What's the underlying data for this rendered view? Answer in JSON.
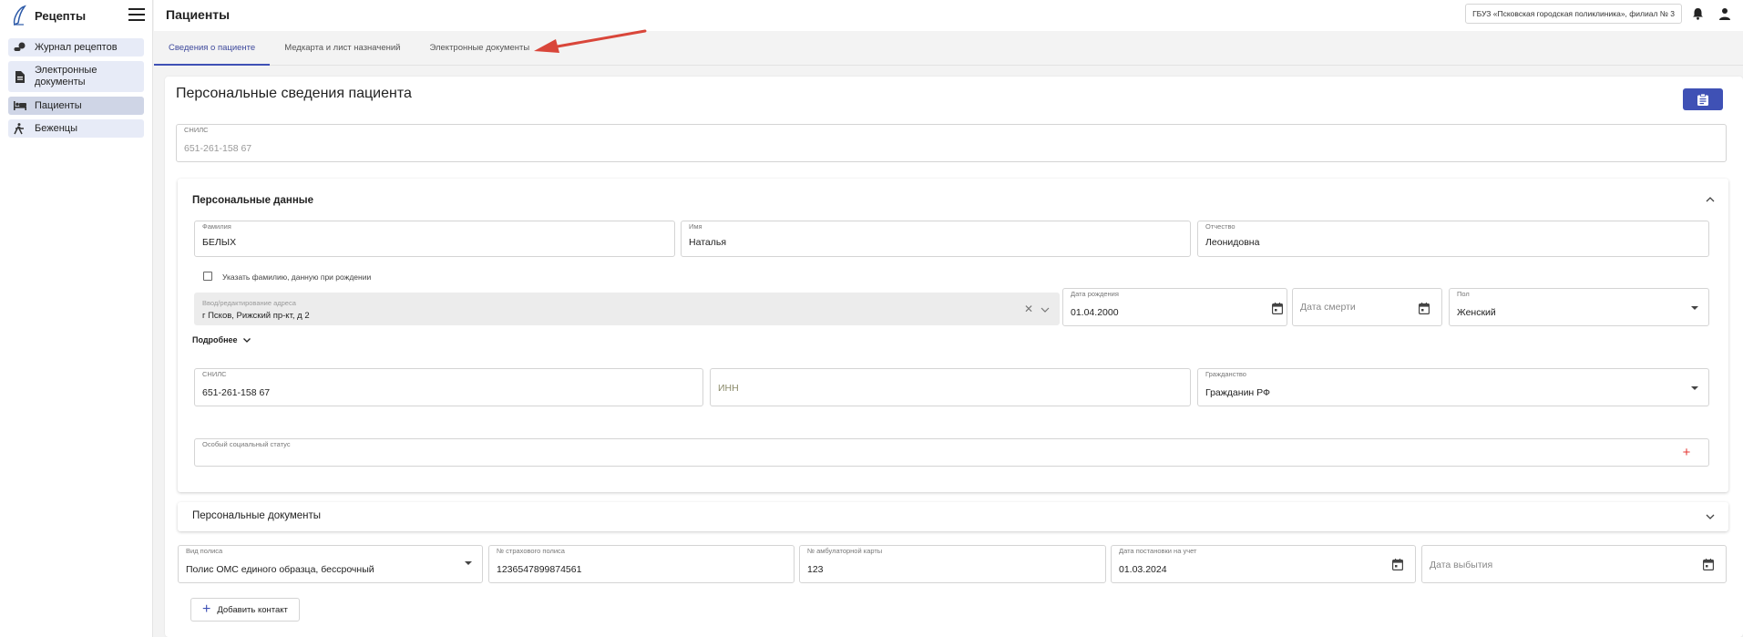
{
  "app": {
    "title": "Рецепты"
  },
  "sidebar": {
    "items": [
      {
        "label": "Журнал рецептов",
        "icon": "pills-icon"
      },
      {
        "label": "Электронные документы",
        "icon": "document-icon"
      },
      {
        "label": "Пациенты",
        "icon": "bed-icon",
        "active": true
      },
      {
        "label": "Беженцы",
        "icon": "walking-person-icon"
      }
    ]
  },
  "header": {
    "title": "Пациенты",
    "organization": "ГБУЗ «Псковская городская поликлиника», филиал № 3"
  },
  "tabs": [
    {
      "label": "Сведения о пациенте",
      "active": true
    },
    {
      "label": "Медкарта и лист назначений"
    },
    {
      "label": "Электронные документы"
    }
  ],
  "main": {
    "heading": "Персональные сведения пациента",
    "snils_top": {
      "label": "СНИЛС",
      "value": "651-261-158 67"
    },
    "personal": {
      "title": "Персональные данные",
      "surname": {
        "label": "Фамилия",
        "value": "БЕЛЫХ"
      },
      "name": {
        "label": "Имя",
        "value": "Наталья"
      },
      "patronymic": {
        "label": "Отчество",
        "value": "Леонидовна"
      },
      "birth_surname_checkbox": "Указать фамилию, данную при рождении",
      "address": {
        "label": "Ввод/редактирование адреса",
        "value": "г Псков, Рижский пр-кт, д 2"
      },
      "birth_date": {
        "label": "Дата рождения",
        "value": "01.04.2000"
      },
      "death_date": {
        "placeholder": "Дата смерти"
      },
      "sex": {
        "label": "Пол",
        "value": "Женский"
      },
      "more": "Подробнее",
      "snils": {
        "label": "СНИЛС",
        "value": "651-261-158 67"
      },
      "inn": {
        "placeholder": "ИНН"
      },
      "citizenship": {
        "label": "Гражданство",
        "value": "Гражданин РФ"
      },
      "social_status": {
        "label": "Особый социальный статус"
      }
    },
    "documents": {
      "title": "Персональные документы"
    },
    "policy": {
      "type": {
        "label": "Вид полиса",
        "value": "Полис ОМС единого образца, бессрочный"
      },
      "number": {
        "label": "№ страхового полиса",
        "value": "1236547899874561"
      },
      "card": {
        "label": "№ амбулаторной карты",
        "value": "123"
      },
      "registration_date": {
        "label": "Дата постановки на учет",
        "value": "01.03.2024"
      },
      "leave_date": {
        "placeholder": "Дата выбытия"
      }
    },
    "add_contact": "Добавить контакт"
  },
  "colors": {
    "accent": "#3f51b5",
    "arrow": "#d9463a",
    "add_icon": "#e53935"
  }
}
